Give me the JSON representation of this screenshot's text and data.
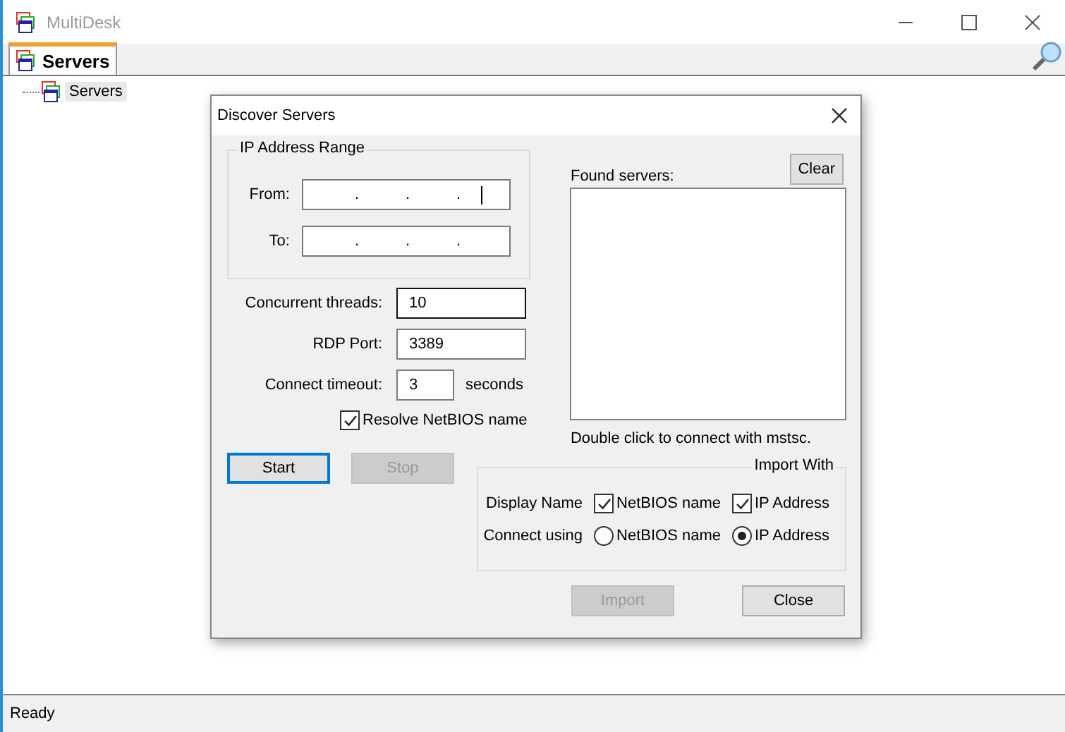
{
  "window": {
    "title": "MultiDesk"
  },
  "tabs": [
    {
      "label": "Servers",
      "selected": true
    }
  ],
  "tree": [
    {
      "label": "Servers",
      "selected": true
    }
  ],
  "dialog": {
    "title": "Discover Servers",
    "ip_range": {
      "title": "IP Address Range",
      "fields": [
        {
          "label": "From:",
          "separators": [
            ".",
            ".",
            "."
          ],
          "focused": true
        },
        {
          "label": "To:",
          "separators": [
            ".",
            ".",
            "."
          ],
          "focused": false
        }
      ]
    },
    "settings": [
      {
        "label": "Concurrent threads:",
        "value": "10",
        "hovered": true
      },
      {
        "label": "RDP Port:",
        "value": "3389",
        "hovered": false
      },
      {
        "label": "Connect timeout:",
        "value": "3",
        "unit": "seconds",
        "hovered": false
      }
    ],
    "resolve": {
      "label": "Resolve NetBIOS name",
      "checked": true
    },
    "scan_buttons": [
      {
        "label": "Start",
        "disabled": false,
        "default": true
      },
      {
        "label": "Stop",
        "disabled": true,
        "default": false
      }
    ],
    "found": {
      "label": "Found servers:",
      "clear": "Clear",
      "hint": "Double click to connect with mstsc."
    },
    "import_with": {
      "title": "Import With",
      "rows": [
        {
          "label": "Display Name",
          "kind": "checkbox",
          "options": [
            {
              "label": "NetBIOS name",
              "checked": true
            },
            {
              "label": "IP Address",
              "checked": true
            }
          ]
        },
        {
          "label": "Connect using",
          "kind": "radio",
          "options": [
            {
              "label": "NetBIOS name",
              "selected": false
            },
            {
              "label": "IP Address",
              "selected": true
            }
          ]
        }
      ]
    },
    "footer_buttons": [
      {
        "label": "Import",
        "disabled": true
      },
      {
        "label": "Close",
        "disabled": false
      }
    ]
  },
  "status_bar": "Ready"
}
